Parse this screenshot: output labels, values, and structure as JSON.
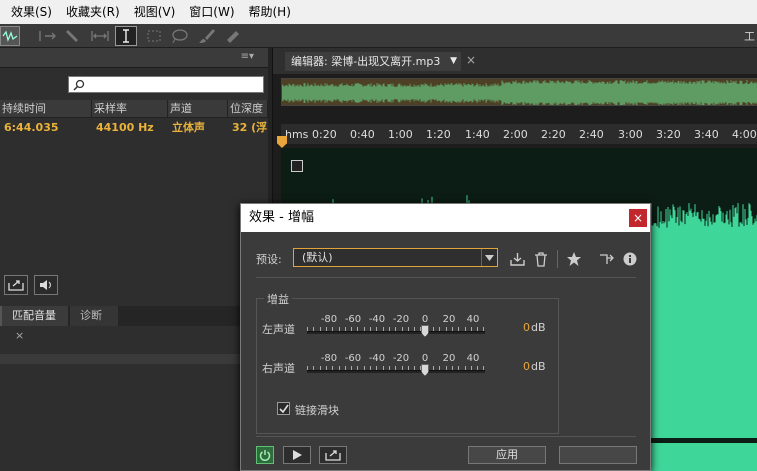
{
  "menu": [
    "效果(S)",
    "收藏夹(R)",
    "视图(V)",
    "窗口(W)",
    "帮助(H)"
  ],
  "workspace_label": "工",
  "files": {
    "columns": [
      "持续时间",
      "采样率",
      "声道",
      "位深度"
    ],
    "row": [
      "6:44.035",
      "44100 Hz",
      "立体声",
      "32 (浮"
    ]
  },
  "lower_tabs": {
    "match": "匹配音量",
    "match_close": "×",
    "diag": "诊断"
  },
  "editor": {
    "tab": "编辑器: 梁博-出现又离开.mp3",
    "tab_close": "×",
    "ruler_unit": "hms",
    "ruler_ticks": [
      "0:20",
      "0:40",
      "1:00",
      "1:20",
      "1:40",
      "2:00",
      "2:20",
      "2:40",
      "3:00",
      "3:20",
      "3:40",
      "4:00"
    ]
  },
  "dialog": {
    "title": "效果 - 增幅",
    "close": "×",
    "preset_label": "预设:",
    "preset_value": "(默认)",
    "gain_label": "增益",
    "left_label": "左声道",
    "right_label": "右声道",
    "scale": [
      "-80",
      "-60",
      "-40",
      "-20",
      "0",
      "20",
      "40"
    ],
    "left_value": "0",
    "right_value": "0",
    "unit": "dB",
    "link_label": "链接滑块",
    "link_checked": true,
    "apply": "应用"
  },
  "colors": {
    "wave": "#3fd69a",
    "accent": "#e9a53a",
    "close_red": "#c1272d"
  }
}
